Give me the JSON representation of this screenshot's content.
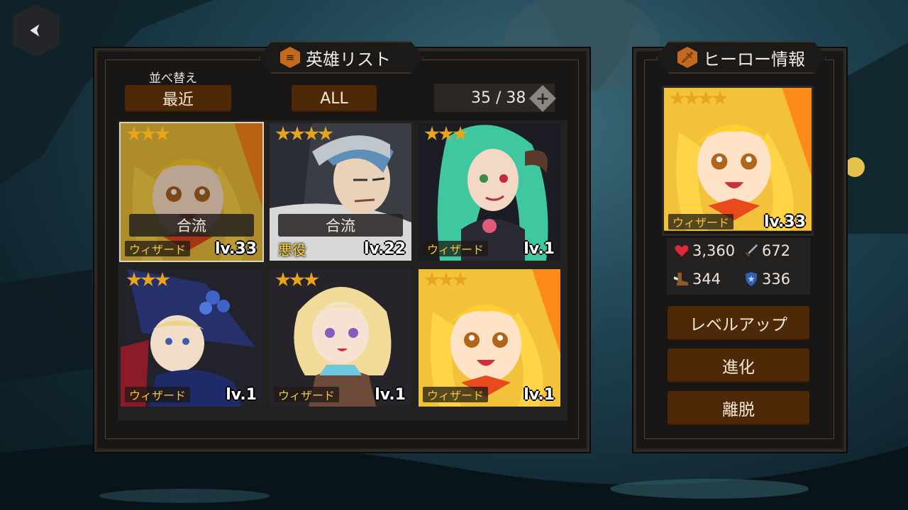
{
  "nav": {
    "back_icon": "back-arrow-icon"
  },
  "hero_list": {
    "title": "英雄リスト",
    "title_icon": "menu-list-icon",
    "sort_caption": "並べ替え",
    "sort_value": "最近",
    "filter_value": "ALL",
    "count": "35 / 38",
    "add_icon": "plus-icon",
    "cards": [
      {
        "stars": 3,
        "class_label": "ウィザード",
        "level": "lv.33",
        "status": "合流",
        "selected": true,
        "art": "blonde-wizard"
      },
      {
        "stars": 4,
        "class_label": "悪役",
        "level": "lv.22",
        "status": "合流",
        "selected": false,
        "art": "bandana-villain"
      },
      {
        "stars": 3,
        "class_label": "ウィザード",
        "level": "lv.1",
        "status": "",
        "selected": false,
        "art": "green-hair"
      },
      {
        "stars": 3,
        "class_label": "ウィザード",
        "level": "lv.1",
        "status": "",
        "selected": false,
        "art": "witch-hat"
      },
      {
        "stars": 3,
        "class_label": "ウィザード",
        "level": "lv.1",
        "status": "",
        "selected": false,
        "art": "blonde-bow"
      },
      {
        "stars": 3,
        "class_label": "ウィザード",
        "level": "lv.1",
        "status": "",
        "selected": false,
        "art": "blonde-wizard"
      }
    ]
  },
  "hero_info": {
    "title": "ヒーロー情報",
    "title_icon": "sword-icon",
    "portrait": {
      "stars": 4,
      "class_label": "ウィザード",
      "level": "lv.33"
    },
    "stats": {
      "hp": "3,360",
      "attack": "672",
      "speed": "344",
      "defense": "336"
    },
    "buttons": {
      "level_up": "レベルアップ",
      "evolve": "進化",
      "leave": "離脱"
    }
  },
  "colors": {
    "button_brown": "#4d2908",
    "star_gold": "#e8a51c",
    "class_text": "#f4c542",
    "panel_bg": "#181716"
  }
}
